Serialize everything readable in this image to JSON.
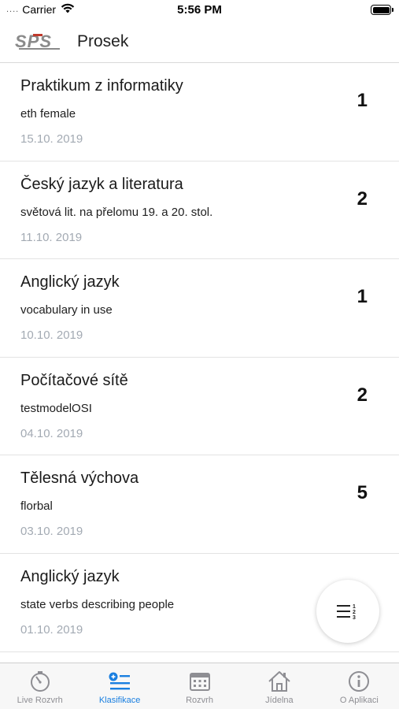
{
  "status_bar": {
    "signal": "....",
    "carrier": "Carrier",
    "time": "5:56 PM"
  },
  "nav": {
    "logo_text": "SPS",
    "title": "Prosek"
  },
  "grades": [
    {
      "subject": "Praktikum z informatiky",
      "topic": "eth female",
      "date": "15.10. 2019",
      "grade": "1"
    },
    {
      "subject": "Český jazyk a literatura",
      "topic": "světová lit. na přelomu 19. a 20. stol.",
      "date": "11.10. 2019",
      "grade": "2"
    },
    {
      "subject": "Anglický jazyk",
      "topic": "vocabulary in use",
      "date": "10.10. 2019",
      "grade": "1"
    },
    {
      "subject": "Počítačové sítě",
      "topic": "testmodelOSI",
      "date": "04.10. 2019",
      "grade": "2"
    },
    {
      "subject": "Tělesná výchova",
      "topic": "florbal",
      "date": "03.10. 2019",
      "grade": "5"
    },
    {
      "subject": "Anglický jazyk",
      "topic": "state verbs  describing people",
      "date": "01.10. 2019",
      "grade": ""
    }
  ],
  "fab": {
    "icon": "sort-numbered-list-icon"
  },
  "tabs": [
    {
      "label": "Live Rozvrh",
      "icon": "stopwatch-icon"
    },
    {
      "label": "Klasifikace",
      "icon": "grades-list-icon"
    },
    {
      "label": "Rozvrh",
      "icon": "calendar-icon"
    },
    {
      "label": "Jídelna",
      "icon": "house-icon"
    },
    {
      "label": "O Aplikaci",
      "icon": "info-icon"
    }
  ],
  "colors": {
    "accent": "#1a7fe0",
    "inactive": "#8e8e93",
    "date": "#a3aab3",
    "logo_red": "#c0392b",
    "logo_gray": "#8a8a8a"
  }
}
